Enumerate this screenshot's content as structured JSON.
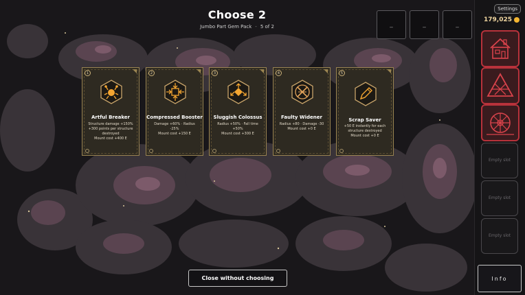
{
  "header": {
    "title": "Choose 2",
    "pack_name": "Jumbo Part Gem Pack",
    "separator": "-",
    "progress": "5 of 2"
  },
  "top_slots": [
    {
      "label": "_"
    },
    {
      "label": "_"
    },
    {
      "label": "_"
    }
  ],
  "sidebar": {
    "settings_label": "Settings",
    "money": "179,025",
    "tools": [
      {
        "icon": "house-icon"
      },
      {
        "icon": "tent-icon"
      },
      {
        "icon": "waterwheel-icon"
      }
    ],
    "empty_slots": [
      {
        "label": "Empty slot"
      },
      {
        "label": "Empty slot"
      },
      {
        "label": "Empty slot"
      }
    ],
    "info_label": "Info"
  },
  "cards": [
    {
      "number": "1",
      "icon": "crab-gem-icon",
      "title": "Artful Breaker",
      "desc": "Structure damage +150%\n+300 points per structure\ndestroyed\nMount cost +400 E"
    },
    {
      "number": "2",
      "icon": "compress-arrows-icon",
      "title": "Compressed Booster",
      "desc": "Damage +60% · Radius -25%\nMount cost +150 E"
    },
    {
      "number": "3",
      "icon": "split-arrows-icon",
      "title": "Sluggish Colossus",
      "desc": "Radius +50% · Fall time +50%\nMount cost +300 E"
    },
    {
      "number": "4",
      "icon": "widener-crossed-icon",
      "title": "Faulty Widener",
      "desc": "Radius +80 · Damage -30\nMount cost +0 E"
    },
    {
      "number": "5",
      "icon": "pencil-icon",
      "title": "Scrap Saver",
      "desc": "+50 E instantly for each\nstructure destroyed\nMount cost +0 E"
    }
  ],
  "close_button": {
    "label": "Close without choosing"
  },
  "colors": {
    "accent": "#f3a531",
    "card_border": "#9a8451",
    "active_tool": "#b8323b",
    "coin": "#f3b531"
  }
}
